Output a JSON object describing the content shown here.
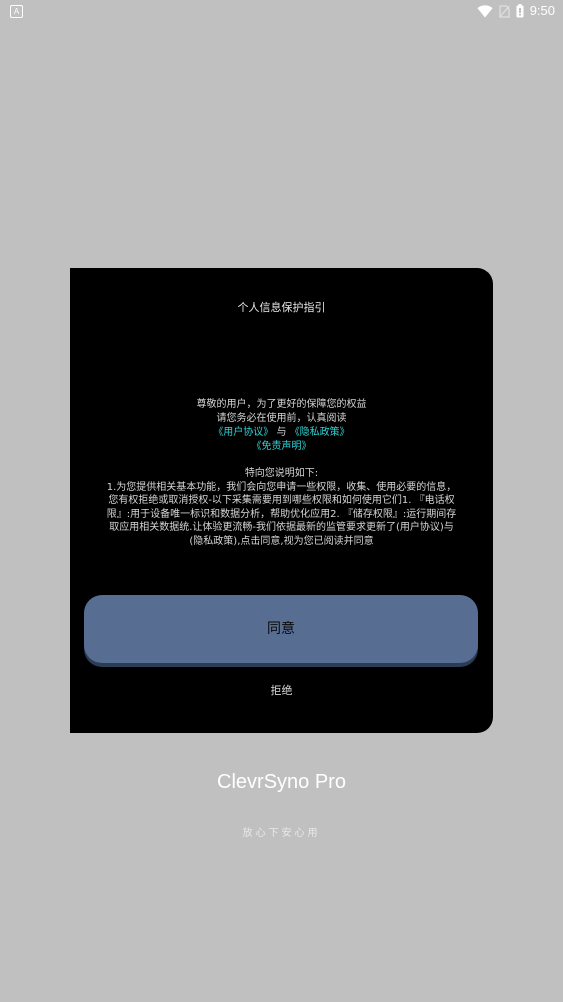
{
  "status_bar": {
    "left_icon": "A",
    "time": "9:50",
    "icons": [
      "wifi-icon",
      "no-sim-icon",
      "battery-icon"
    ]
  },
  "dialog": {
    "title": "个人信息保护指引",
    "intro_line1": "尊敬的用户，为了更好的保障您的权益",
    "intro_line2": "请您务必在使用前，认真阅读",
    "user_agreement_link": "《用户协议》",
    "conjunction": "与",
    "privacy_policy_link": "《隐私政策》",
    "disclaimer_link": "《免责声明》",
    "details_heading": "特向您说明如下:",
    "details_lines": [
      "1.为您提供相关基本功能，我们会向您申请一些权限，收集、使用必要的信息，",
      "您有权拒绝或取消授权-以下采集需要用到哪些权限和如何使用它们1. 『电话权",
      "限』:用于设备唯一标识和数据分析，帮助优化应用2. 『储存权限』:运行期间存",
      "取应用相关数据统.让体验更流畅-我们依据最新的监管要求更新了(用户协议)与",
      "(隐私政策),点击同意,视为您已阅读并同意"
    ],
    "agree_label": "同意",
    "reject_label": "拒绝"
  },
  "app": {
    "name": "ClevrSyno Pro",
    "slogan": "放心下安心用"
  },
  "colors": {
    "background": "#c0c0c0",
    "dialog_bg": "#000000",
    "link": "#2fd3d3",
    "agree_button": "#576d92"
  }
}
